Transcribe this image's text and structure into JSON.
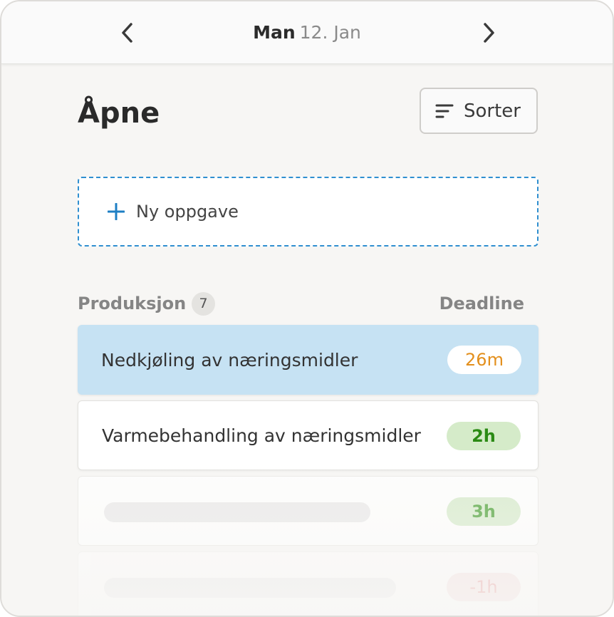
{
  "header": {
    "day": "Man",
    "date": "12. Jan",
    "prev_icon": "chevron-left-icon",
    "next_icon": "chevron-right-icon"
  },
  "main": {
    "title": "Åpne",
    "sort_label": "Sorter",
    "sort_icon": "sort-lines-icon",
    "new_task_label": "Ny oppgave",
    "new_task_icon": "plus-icon"
  },
  "section": {
    "name": "Produksjon",
    "count": "7",
    "deadline_header": "Deadline"
  },
  "tasks": [
    {
      "title": "Nedkjøling av næringsmidler",
      "deadline": "26m",
      "state": "selected",
      "color": "#e38f1c"
    },
    {
      "title": "Varmebehandling av næringsmidler",
      "deadline": "2h",
      "state": "normal",
      "color": "#2b8a14"
    },
    {
      "title": "",
      "deadline": "3h",
      "state": "loading",
      "color": "#3e9a26"
    },
    {
      "title": "",
      "deadline": "-1h",
      "state": "loading",
      "color": "#e07a7a"
    }
  ],
  "colors": {
    "accent": "#2f8fd0",
    "selected_bg": "#c6e2f3",
    "ok_pill_bg": "#d5ebc9",
    "overdue_pill_bg": "#f5dcdc"
  }
}
